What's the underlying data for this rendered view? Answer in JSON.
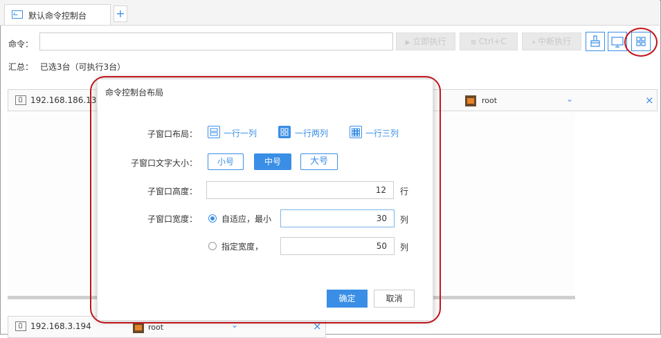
{
  "tab": {
    "label": "默认命令控制台",
    "add_symbol": "+"
  },
  "command": {
    "label": "命令：",
    "input_value": "",
    "execute_label": "立即执行",
    "ctrlc_label": "Ctrl+C",
    "interrupt_label": "中断执行"
  },
  "summary": {
    "label": "汇总：",
    "text": "已选3台（可执行3台）"
  },
  "panels": [
    {
      "ip": "192.168.186.133",
      "user": "root",
      "chevron": "⌄",
      "close": "×"
    },
    {
      "ip": "192.168.3.194",
      "user": "root",
      "chevron": "⌄",
      "close": "×"
    }
  ],
  "dialog": {
    "title": "命令控制台布局",
    "layout_label": "子窗口布局：",
    "layout_options": [
      "一行一列",
      "一行两列",
      "一行三列"
    ],
    "layout_selected": "一行两列",
    "font_label": "子窗口文字大小：",
    "font_options": [
      "小号",
      "中号",
      "大号"
    ],
    "font_selected": "中号",
    "height_label": "子窗口高度：",
    "height_value": "12",
    "height_unit": "行",
    "width_label": "子窗口宽度：",
    "width_auto_label": "自适应，最小",
    "width_auto_value": "30",
    "width_auto_unit": "列",
    "width_fixed_label": "指定宽度，",
    "width_fixed_value": "50",
    "width_fixed_unit": "列",
    "ok_label": "确定",
    "cancel_label": "取消"
  },
  "colors": {
    "accent": "#3a8ee6",
    "annotation": "#c0141c"
  }
}
